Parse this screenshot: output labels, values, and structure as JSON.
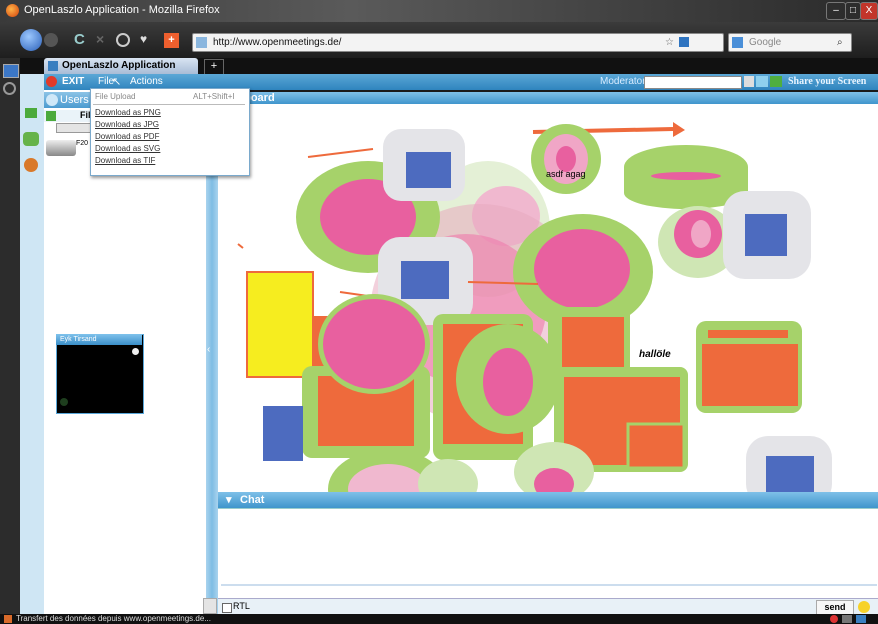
{
  "browser": {
    "window_title": "OpenLaszlo Application - Mozilla Firefox",
    "url": "http://www.openmeetings.de/",
    "search_placeholder": "Google",
    "tab_title": "OpenLaszlo Application",
    "new_tab": "+",
    "status_text": "Transfert des données depuis www.openmeetings.de..."
  },
  "window_controls": {
    "minimize": "–",
    "maximize": "□",
    "close": "X"
  },
  "app": {
    "menu": {
      "exit": "EXIT",
      "file": "File",
      "actions": "Actions"
    },
    "moderator_label": "Moderator:",
    "share_screen": "Share your Screen",
    "users_header": "Users",
    "files_label": "File",
    "file_item": "F20",
    "whiteboard_title": "eboard",
    "chat_title": "Chat",
    "rtl_label": "RTL",
    "send_label": "send"
  },
  "file_menu": {
    "upload_label": "File Upload",
    "upload_shortcut": "ALT+Shift+I",
    "items": [
      "Download as PNG",
      "Download as JPG",
      "Download as PDF",
      "Download as SVG",
      "Download as TIF"
    ]
  },
  "video_pod": {
    "title": "Eyk Tirsand"
  },
  "whiteboard_texts": {
    "label1": "asdf agag",
    "label2": "hallöle"
  },
  "colors": {
    "accent_blue": "#3f95cc",
    "wb_green": "#a6d26a",
    "wb_pink": "#e8609f",
    "wb_orange": "#ee6a3c",
    "wb_blue": "#4d6bbf",
    "wb_gray": "#e4e4e8",
    "wb_yellow": "#f6ed1f"
  }
}
